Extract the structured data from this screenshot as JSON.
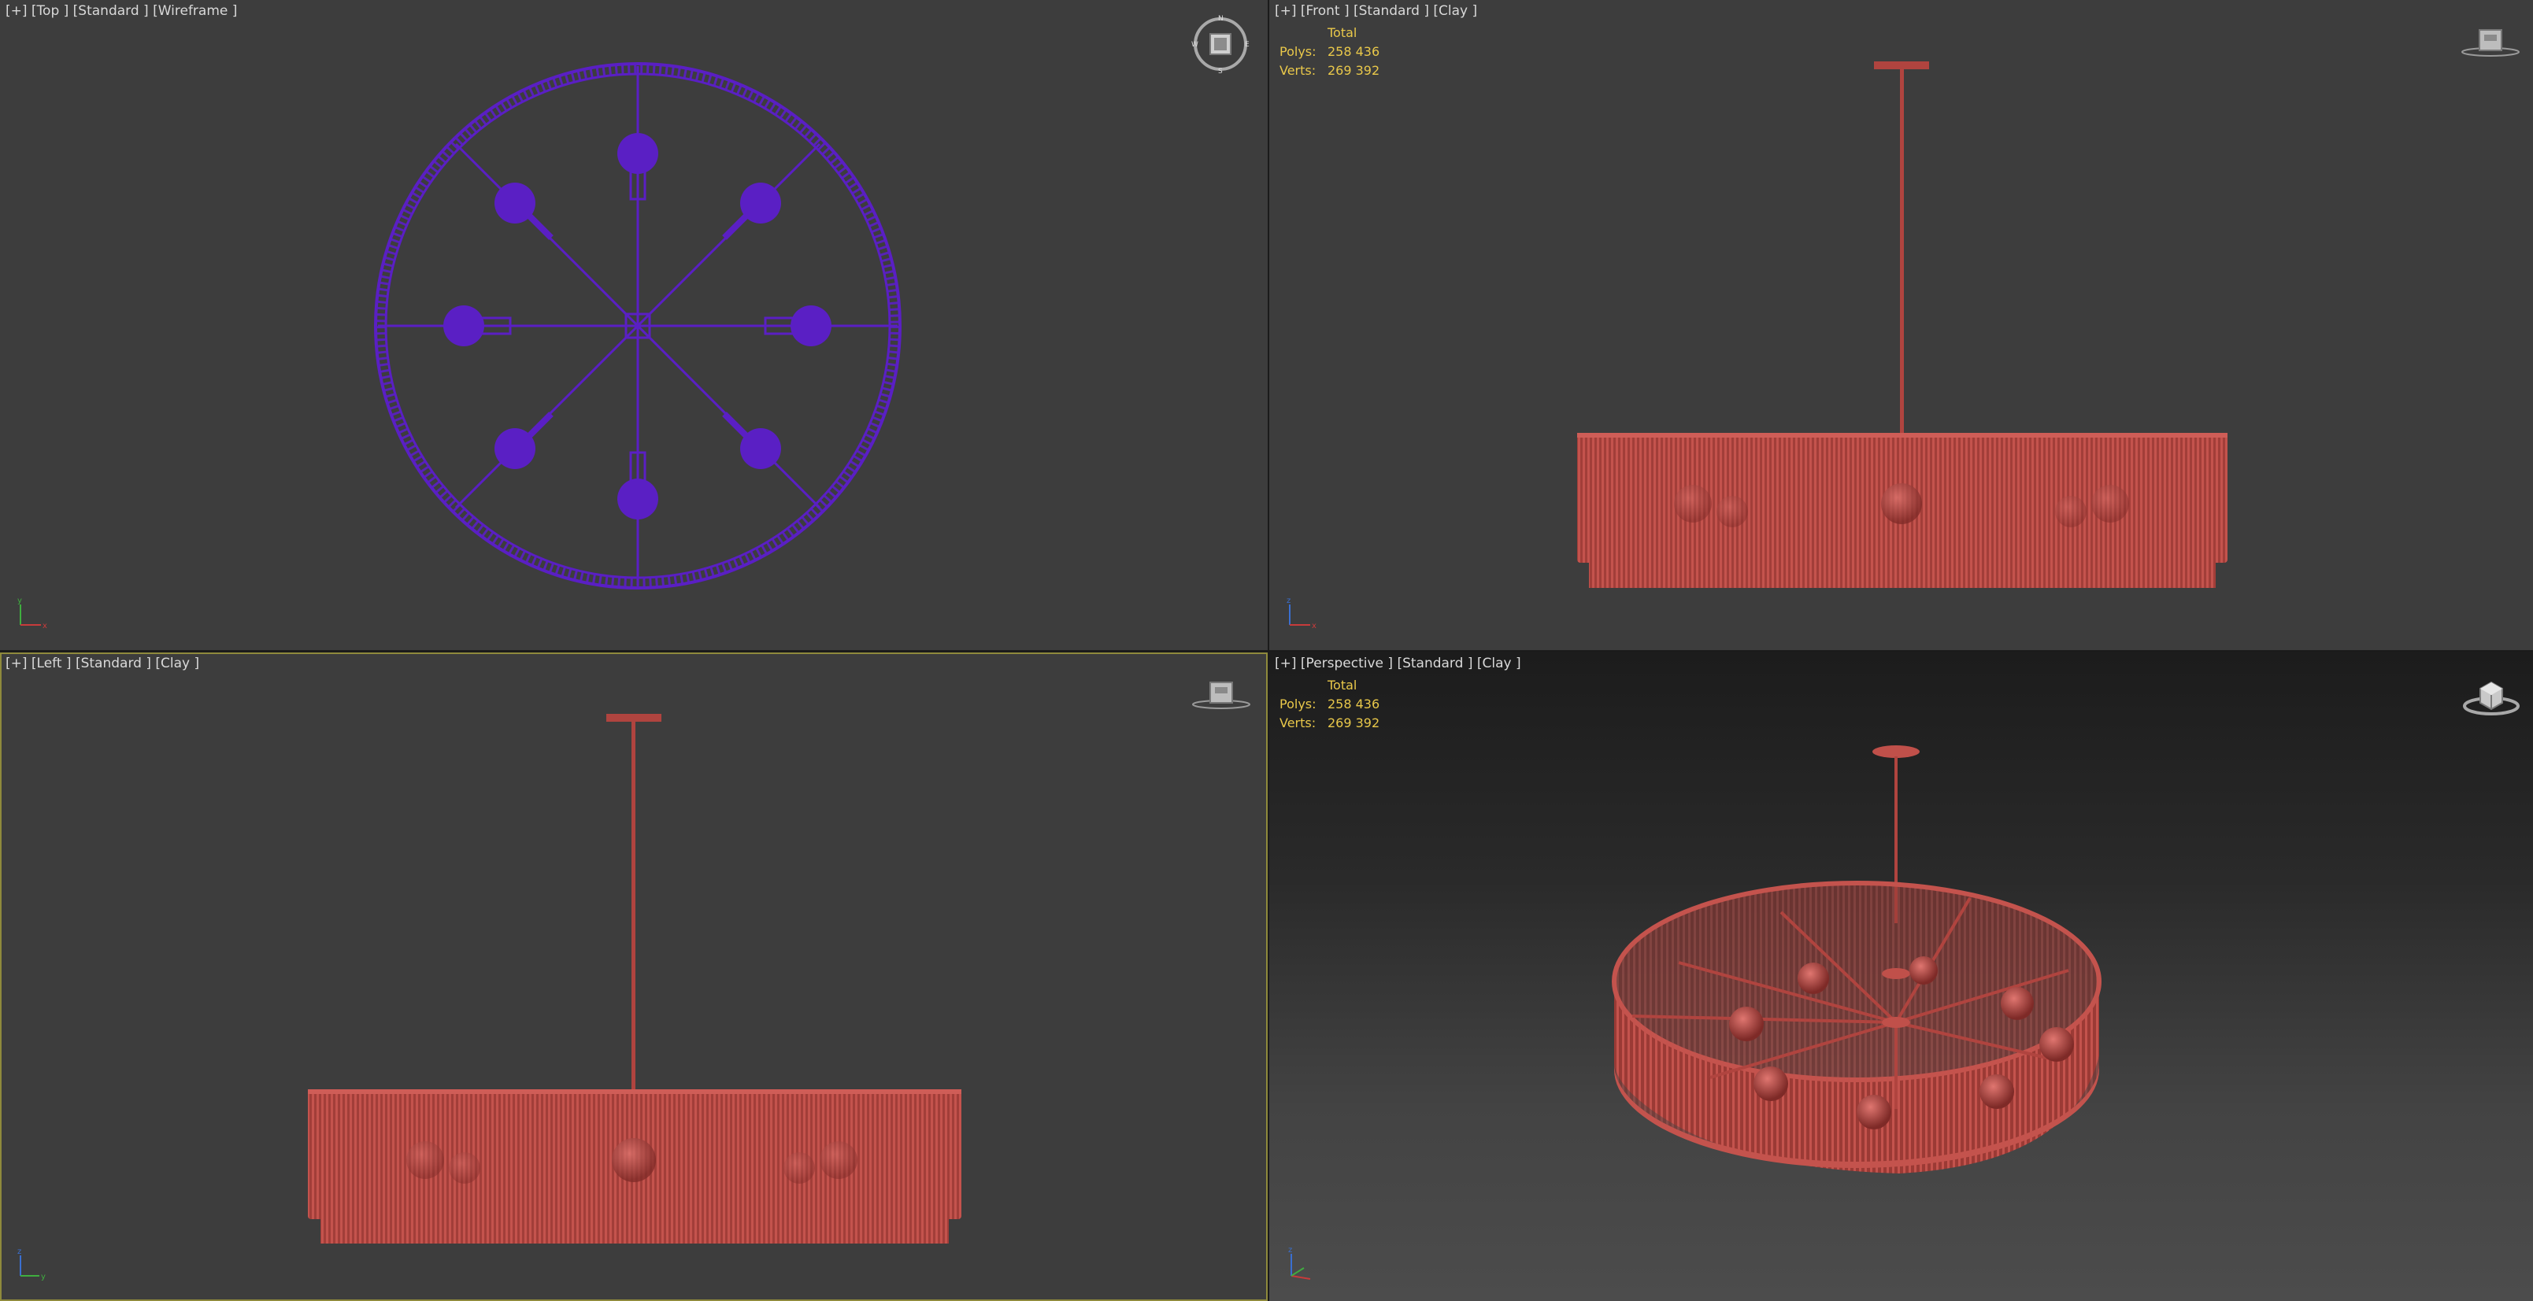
{
  "viewports": {
    "top": {
      "label": "[+] [Top ] [Standard ] [Wireframe ]"
    },
    "front": {
      "label": "[+] [Front ] [Standard ] [Clay ]",
      "stats": {
        "total": "Total",
        "polys_label": "Polys:",
        "polys": "258 436",
        "verts_label": "Verts:",
        "verts": "269 392"
      }
    },
    "left": {
      "label": "[+] [Left ] [Standard ] [Clay ]"
    },
    "perspective": {
      "label": "[+] [Perspective ] [Standard ] [Clay ]",
      "stats": {
        "total": "Total",
        "polys_label": "Polys:",
        "polys": "258 436",
        "verts_label": "Verts:",
        "verts": "269 392"
      }
    }
  },
  "colors": {
    "wireframe": "#5a1fc4",
    "clay": "#b0443f",
    "stats_text": "#e9c84a",
    "active_border": "#8f8a3c",
    "viewport_bg": "#3d3d3d"
  },
  "icons": {
    "top_nav": "viewcube-compass-icon",
    "front_nav": "viewcube-icon",
    "left_nav": "viewcube-icon",
    "persp_nav": "viewcube-perspective-icon",
    "axis": "axis-tripod-icon"
  }
}
